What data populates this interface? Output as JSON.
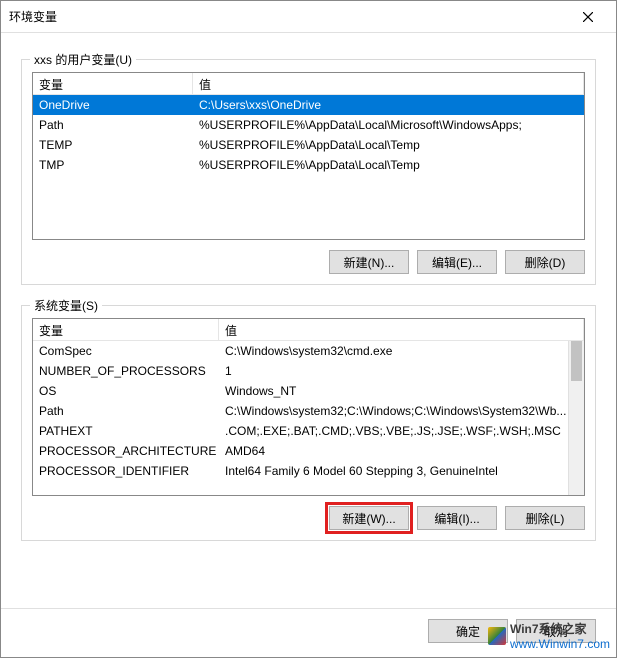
{
  "window": {
    "title": "环境变量"
  },
  "user_section": {
    "legend": "xxs 的用户变量(U)",
    "header_name": "变量",
    "header_value": "值",
    "rows": [
      {
        "name": "OneDrive",
        "value": "C:\\Users\\xxs\\OneDrive",
        "selected": true
      },
      {
        "name": "Path",
        "value": "%USERPROFILE%\\AppData\\Local\\Microsoft\\WindowsApps;",
        "selected": false
      },
      {
        "name": "TEMP",
        "value": "%USERPROFILE%\\AppData\\Local\\Temp",
        "selected": false
      },
      {
        "name": "TMP",
        "value": "%USERPROFILE%\\AppData\\Local\\Temp",
        "selected": false
      }
    ],
    "btn_new": "新建(N)...",
    "btn_edit": "编辑(E)...",
    "btn_delete": "删除(D)"
  },
  "system_section": {
    "legend": "系统变量(S)",
    "header_name": "变量",
    "header_value": "值",
    "rows": [
      {
        "name": "ComSpec",
        "value": "C:\\Windows\\system32\\cmd.exe"
      },
      {
        "name": "NUMBER_OF_PROCESSORS",
        "value": "1"
      },
      {
        "name": "OS",
        "value": "Windows_NT"
      },
      {
        "name": "Path",
        "value": "C:\\Windows\\system32;C:\\Windows;C:\\Windows\\System32\\Wb..."
      },
      {
        "name": "PATHEXT",
        "value": ".COM;.EXE;.BAT;.CMD;.VBS;.VBE;.JS;.JSE;.WSF;.WSH;.MSC"
      },
      {
        "name": "PROCESSOR_ARCHITECTURE",
        "value": "AMD64"
      },
      {
        "name": "PROCESSOR_IDENTIFIER",
        "value": "Intel64 Family 6 Model 60 Stepping 3, GenuineIntel"
      }
    ],
    "btn_new": "新建(W)...",
    "btn_edit": "编辑(I)...",
    "btn_delete": "删除(L)"
  },
  "dialog": {
    "ok": "确定",
    "cancel": "取消"
  },
  "watermark": {
    "brand": "Win7系统之家",
    "url": "www.Winwin7.com"
  }
}
